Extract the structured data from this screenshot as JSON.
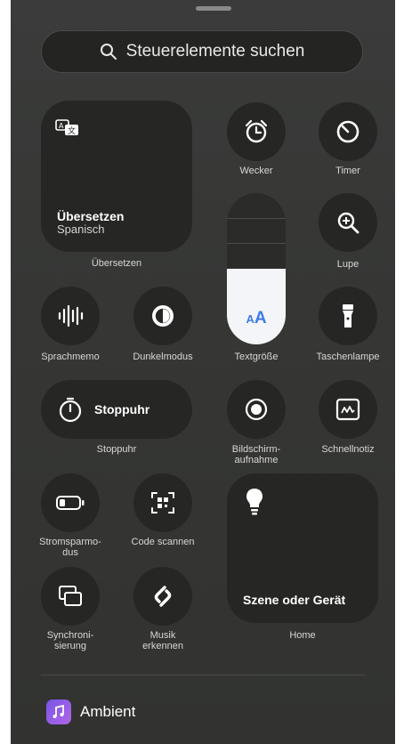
{
  "search": {
    "placeholder": "Steuerelemente suchen"
  },
  "controls": {
    "translate": {
      "title": "Übersetzen",
      "subtitle": "Spanisch",
      "label": "Übersetzen"
    },
    "alarm": {
      "label": "Wecker"
    },
    "timer": {
      "label": "Timer"
    },
    "magnifier": {
      "label": "Lupe"
    },
    "voice_memo": {
      "label": "Sprachmemo"
    },
    "dark_mode": {
      "label": "Dunkelmodus"
    },
    "text_size": {
      "label": "Textgröße",
      "glyph": "AA",
      "level": 0.5
    },
    "flashlight": {
      "label": "Taschenlampe"
    },
    "stopwatch": {
      "title": "Stoppuhr",
      "label": "Stoppuhr"
    },
    "screen_recording": {
      "label_line1": "Bildschirm-",
      "label_line2": "aufnahme"
    },
    "quick_note": {
      "label": "Schnellnotiz"
    },
    "low_power": {
      "label_line1": "Stromsparmo-",
      "label_line2": "dus"
    },
    "code_scanner": {
      "label": "Code scannen"
    },
    "home": {
      "title": "Szene oder Gerät",
      "label": "Home"
    },
    "mirroring": {
      "label_line1": "Synchroni-",
      "label_line2": "sierung"
    },
    "music_recognition": {
      "label_line1": "Musik",
      "label_line2": "erkennen"
    }
  },
  "section": {
    "label": "Ambient"
  },
  "colors": {
    "panel": "#363735",
    "tile": "#262725",
    "accent": "#3d7be6"
  }
}
